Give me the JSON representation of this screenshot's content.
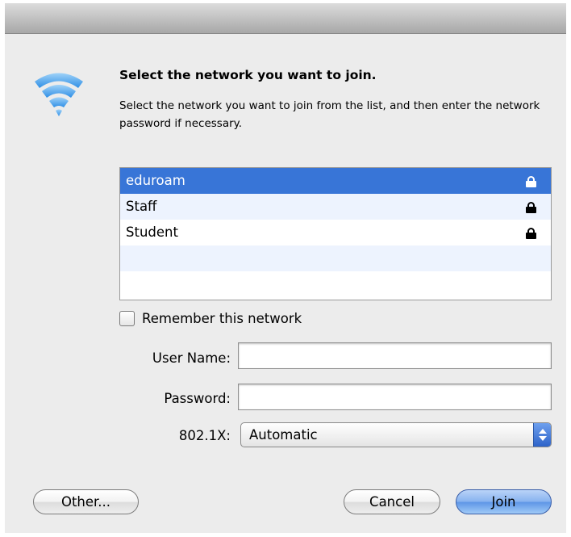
{
  "dialog": {
    "heading": "Select the network you want to join.",
    "description": "Select the network you want to join from the list, and then enter the network password if necessary."
  },
  "networks": [
    {
      "name": "eduroam",
      "secured": true,
      "selected": true
    },
    {
      "name": "Staff",
      "secured": true,
      "selected": false
    },
    {
      "name": "Student",
      "secured": true,
      "selected": false
    }
  ],
  "remember": {
    "label": "Remember this network",
    "checked": false
  },
  "form": {
    "username_label": "User Name:",
    "username_value": "",
    "password_label": "Password:",
    "password_value": "",
    "auth_label": "802.1X:",
    "auth_value": "Automatic"
  },
  "buttons": {
    "other": "Other...",
    "cancel": "Cancel",
    "join": "Join"
  },
  "icons": {
    "wifi": "wifi-icon",
    "lock": "lock-icon"
  },
  "colors": {
    "selection": "#3875d7",
    "alt_row": "#edf3fe",
    "default_button": "#5d95e6"
  }
}
